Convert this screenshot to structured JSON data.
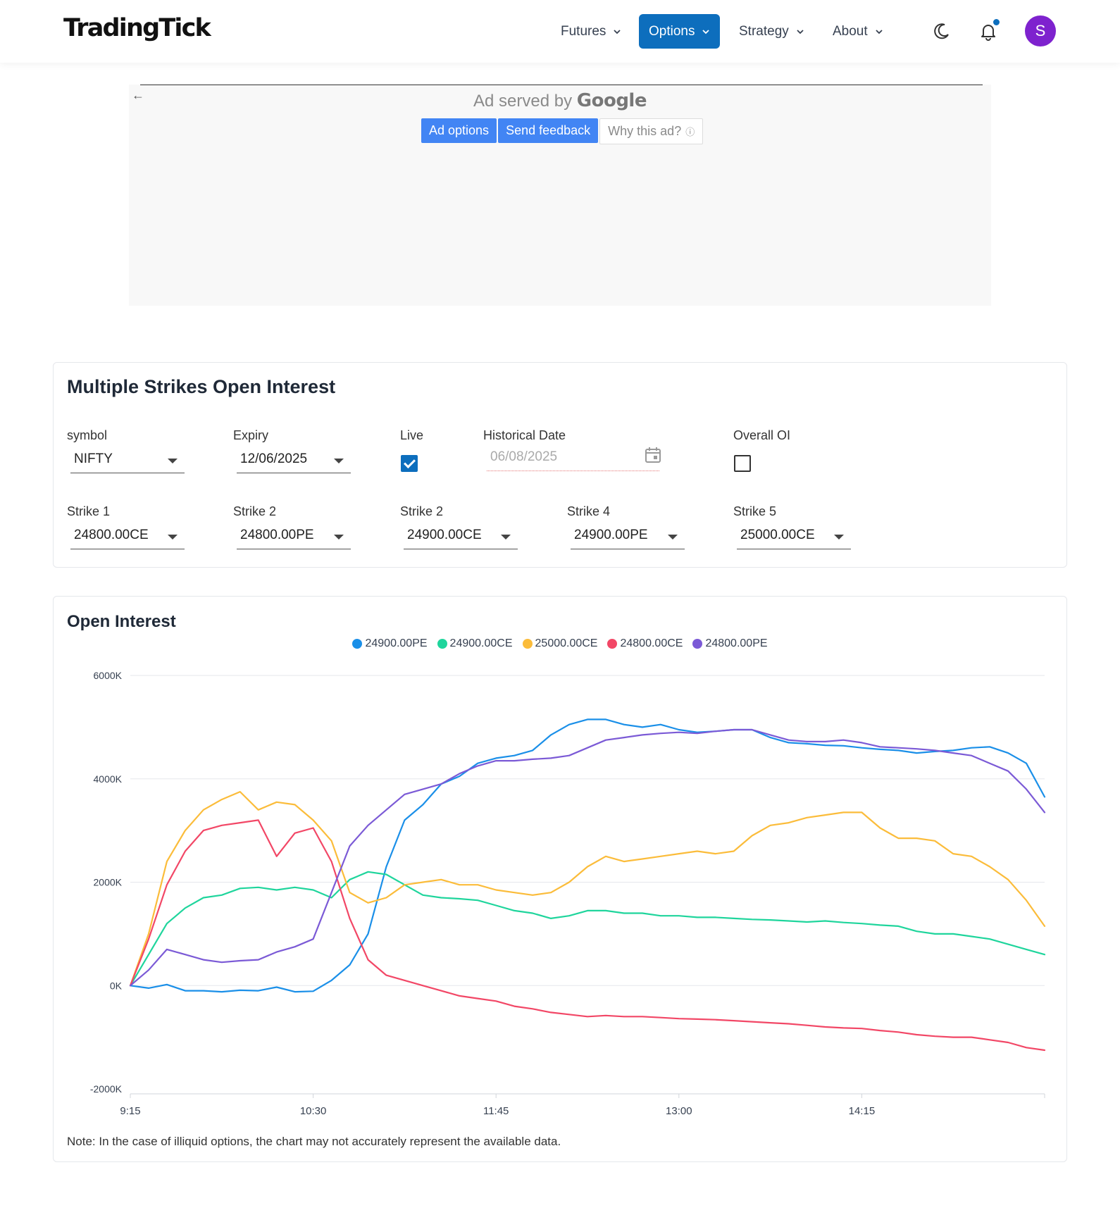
{
  "brand": "TradingTick",
  "nav": {
    "items": [
      {
        "label": "Futures",
        "active": false
      },
      {
        "label": "Options",
        "active": true
      },
      {
        "label": "Strategy",
        "active": false
      },
      {
        "label": "About",
        "active": false
      }
    ],
    "avatar_initial": "S"
  },
  "ad": {
    "served_by": "Ad served by",
    "google": "Google",
    "buttons": [
      "Ad options",
      "Send feedback",
      "Why this ad?"
    ]
  },
  "filters": {
    "title": "Multiple Strikes Open Interest",
    "symbol": {
      "label": "symbol",
      "value": "NIFTY"
    },
    "expiry": {
      "label": "Expiry",
      "value": "12/06/2025"
    },
    "live": {
      "label": "Live",
      "checked": true
    },
    "historical_date": {
      "label": "Historical Date",
      "value": "06/08/2025"
    },
    "overall_oi": {
      "label": "Overall OI",
      "checked": false
    },
    "strikes": [
      {
        "label": "Strike 1",
        "value": "24800.00CE"
      },
      {
        "label": "Strike 2",
        "value": "24800.00PE"
      },
      {
        "label": "Strike 2",
        "value": "24900.00CE"
      },
      {
        "label": "Strike 4",
        "value": "24900.00PE"
      },
      {
        "label": "Strike 5",
        "value": "25000.00CE"
      }
    ]
  },
  "oi_chart": {
    "title": "Open Interest",
    "note": "Note: In the case of illiquid options, the chart may not accurately represent the available data."
  },
  "chart_data": {
    "type": "line",
    "title": "Open Interest",
    "ylim": [
      -2000,
      6000
    ],
    "yticks": [
      "6000K",
      "4000K",
      "2000K",
      "0K",
      "-2000K"
    ],
    "ytick_values": [
      6000,
      4000,
      2000,
      0,
      -2000
    ],
    "xticks": [
      "9:15",
      "10:30",
      "11:45",
      "13:00",
      "14:15"
    ],
    "xtick_minutes": [
      0,
      75,
      150,
      225,
      300
    ],
    "x_range_minutes": [
      0,
      375
    ],
    "grid": true,
    "legend_position": "top-center",
    "series": [
      {
        "name": "24900.00PE",
        "color": "#1a8fe8",
        "points": [
          [
            0,
            0
          ],
          [
            10,
            -50
          ],
          [
            20,
            20
          ],
          [
            30,
            -100
          ],
          [
            40,
            -100
          ],
          [
            50,
            -120
          ],
          [
            60,
            -90
          ],
          [
            70,
            -100
          ],
          [
            80,
            -30
          ],
          [
            90,
            -120
          ],
          [
            100,
            -110
          ],
          [
            110,
            100
          ],
          [
            120,
            400
          ],
          [
            130,
            1000
          ],
          [
            140,
            2300
          ],
          [
            150,
            3200
          ],
          [
            160,
            3500
          ],
          [
            170,
            3900
          ],
          [
            180,
            4050
          ],
          [
            190,
            4300
          ],
          [
            200,
            4400
          ],
          [
            210,
            4450
          ],
          [
            220,
            4550
          ],
          [
            230,
            4850
          ],
          [
            240,
            5050
          ],
          [
            250,
            5150
          ],
          [
            260,
            5150
          ],
          [
            270,
            5050
          ],
          [
            280,
            5000
          ],
          [
            290,
            5050
          ],
          [
            300,
            4950
          ],
          [
            310,
            4900
          ],
          [
            320,
            4920
          ],
          [
            330,
            4950
          ],
          [
            340,
            4950
          ],
          [
            350,
            4800
          ],
          [
            360,
            4700
          ],
          [
            370,
            4680
          ],
          [
            380,
            4650
          ],
          [
            390,
            4640
          ],
          [
            400,
            4600
          ],
          [
            410,
            4570
          ],
          [
            420,
            4550
          ],
          [
            430,
            4500
          ],
          [
            440,
            4530
          ],
          [
            450,
            4550
          ],
          [
            460,
            4600
          ],
          [
            470,
            4620
          ],
          [
            480,
            4500
          ],
          [
            490,
            4300
          ],
          [
            500,
            3650
          ]
        ]
      },
      {
        "name": "24900.00CE",
        "color": "#1fd59c",
        "points": [
          [
            0,
            0
          ],
          [
            10,
            600
          ],
          [
            20,
            1200
          ],
          [
            30,
            1500
          ],
          [
            40,
            1700
          ],
          [
            50,
            1750
          ],
          [
            60,
            1880
          ],
          [
            70,
            1900
          ],
          [
            80,
            1850
          ],
          [
            90,
            1900
          ],
          [
            100,
            1850
          ],
          [
            110,
            1700
          ],
          [
            120,
            2050
          ],
          [
            130,
            2200
          ],
          [
            140,
            2150
          ],
          [
            150,
            1950
          ],
          [
            160,
            1750
          ],
          [
            170,
            1700
          ],
          [
            180,
            1680
          ],
          [
            190,
            1650
          ],
          [
            200,
            1550
          ],
          [
            210,
            1450
          ],
          [
            220,
            1400
          ],
          [
            230,
            1300
          ],
          [
            240,
            1350
          ],
          [
            250,
            1450
          ],
          [
            260,
            1450
          ],
          [
            270,
            1400
          ],
          [
            280,
            1400
          ],
          [
            290,
            1350
          ],
          [
            300,
            1350
          ],
          [
            310,
            1320
          ],
          [
            320,
            1320
          ],
          [
            330,
            1300
          ],
          [
            340,
            1280
          ],
          [
            350,
            1270
          ],
          [
            360,
            1250
          ],
          [
            370,
            1230
          ],
          [
            380,
            1250
          ],
          [
            390,
            1220
          ],
          [
            400,
            1200
          ],
          [
            410,
            1170
          ],
          [
            420,
            1150
          ],
          [
            430,
            1050
          ],
          [
            440,
            1000
          ],
          [
            450,
            1000
          ],
          [
            460,
            950
          ],
          [
            470,
            900
          ],
          [
            480,
            800
          ],
          [
            490,
            700
          ],
          [
            500,
            600
          ]
        ]
      },
      {
        "name": "25000.00CE",
        "color": "#fbbc3a",
        "points": [
          [
            0,
            0
          ],
          [
            10,
            1000
          ],
          [
            20,
            2400
          ],
          [
            30,
            3000
          ],
          [
            40,
            3400
          ],
          [
            50,
            3600
          ],
          [
            60,
            3750
          ],
          [
            70,
            3400
          ],
          [
            80,
            3550
          ],
          [
            90,
            3500
          ],
          [
            100,
            3200
          ],
          [
            110,
            2800
          ],
          [
            120,
            1800
          ],
          [
            130,
            1600
          ],
          [
            140,
            1700
          ],
          [
            150,
            1950
          ],
          [
            160,
            2000
          ],
          [
            170,
            2050
          ],
          [
            180,
            1950
          ],
          [
            190,
            1950
          ],
          [
            200,
            1850
          ],
          [
            210,
            1800
          ],
          [
            220,
            1750
          ],
          [
            230,
            1800
          ],
          [
            240,
            2000
          ],
          [
            250,
            2300
          ],
          [
            260,
            2500
          ],
          [
            270,
            2400
          ],
          [
            280,
            2450
          ],
          [
            290,
            2500
          ],
          [
            300,
            2550
          ],
          [
            310,
            2600
          ],
          [
            320,
            2550
          ],
          [
            330,
            2600
          ],
          [
            340,
            2900
          ],
          [
            350,
            3100
          ],
          [
            360,
            3150
          ],
          [
            370,
            3250
          ],
          [
            380,
            3300
          ],
          [
            390,
            3350
          ],
          [
            400,
            3350
          ],
          [
            410,
            3050
          ],
          [
            420,
            2850
          ],
          [
            430,
            2850
          ],
          [
            440,
            2800
          ],
          [
            450,
            2550
          ],
          [
            460,
            2500
          ],
          [
            470,
            2300
          ],
          [
            480,
            2050
          ],
          [
            490,
            1650
          ],
          [
            500,
            1150
          ]
        ]
      },
      {
        "name": "24800.00CE",
        "color": "#f24766",
        "points": [
          [
            0,
            0
          ],
          [
            10,
            900
          ],
          [
            20,
            1950
          ],
          [
            30,
            2600
          ],
          [
            40,
            3000
          ],
          [
            50,
            3100
          ],
          [
            60,
            3150
          ],
          [
            70,
            3200
          ],
          [
            80,
            2500
          ],
          [
            90,
            2950
          ],
          [
            100,
            3050
          ],
          [
            110,
            2400
          ],
          [
            120,
            1300
          ],
          [
            130,
            500
          ],
          [
            140,
            200
          ],
          [
            150,
            100
          ],
          [
            160,
            0
          ],
          [
            170,
            -100
          ],
          [
            180,
            -200
          ],
          [
            190,
            -250
          ],
          [
            200,
            -300
          ],
          [
            210,
            -400
          ],
          [
            220,
            -450
          ],
          [
            230,
            -520
          ],
          [
            240,
            -560
          ],
          [
            250,
            -600
          ],
          [
            260,
            -580
          ],
          [
            270,
            -600
          ],
          [
            280,
            -600
          ],
          [
            290,
            -620
          ],
          [
            300,
            -640
          ],
          [
            310,
            -650
          ],
          [
            320,
            -660
          ],
          [
            330,
            -680
          ],
          [
            340,
            -700
          ],
          [
            350,
            -720
          ],
          [
            360,
            -740
          ],
          [
            370,
            -770
          ],
          [
            380,
            -800
          ],
          [
            390,
            -820
          ],
          [
            400,
            -830
          ],
          [
            410,
            -870
          ],
          [
            420,
            -900
          ],
          [
            430,
            -950
          ],
          [
            440,
            -980
          ],
          [
            450,
            -1000
          ],
          [
            460,
            -1000
          ],
          [
            470,
            -1050
          ],
          [
            480,
            -1100
          ],
          [
            490,
            -1200
          ],
          [
            500,
            -1250
          ]
        ]
      },
      {
        "name": "24800.00PE",
        "color": "#7b5ad6",
        "points": [
          [
            0,
            0
          ],
          [
            10,
            300
          ],
          [
            20,
            700
          ],
          [
            30,
            600
          ],
          [
            40,
            500
          ],
          [
            50,
            450
          ],
          [
            60,
            480
          ],
          [
            70,
            500
          ],
          [
            80,
            650
          ],
          [
            90,
            750
          ],
          [
            100,
            900
          ],
          [
            110,
            1800
          ],
          [
            120,
            2700
          ],
          [
            130,
            3100
          ],
          [
            140,
            3400
          ],
          [
            150,
            3700
          ],
          [
            160,
            3800
          ],
          [
            170,
            3900
          ],
          [
            180,
            4100
          ],
          [
            190,
            4250
          ],
          [
            200,
            4350
          ],
          [
            210,
            4350
          ],
          [
            220,
            4380
          ],
          [
            230,
            4400
          ],
          [
            240,
            4450
          ],
          [
            250,
            4600
          ],
          [
            260,
            4750
          ],
          [
            270,
            4800
          ],
          [
            280,
            4850
          ],
          [
            290,
            4880
          ],
          [
            300,
            4900
          ],
          [
            310,
            4880
          ],
          [
            320,
            4920
          ],
          [
            330,
            4950
          ],
          [
            340,
            4950
          ],
          [
            350,
            4850
          ],
          [
            360,
            4750
          ],
          [
            370,
            4720
          ],
          [
            380,
            4720
          ],
          [
            390,
            4750
          ],
          [
            400,
            4700
          ],
          [
            410,
            4620
          ],
          [
            420,
            4600
          ],
          [
            430,
            4580
          ],
          [
            440,
            4550
          ],
          [
            450,
            4500
          ],
          [
            460,
            4450
          ],
          [
            470,
            4300
          ],
          [
            480,
            4150
          ],
          [
            490,
            3800
          ],
          [
            500,
            3350
          ]
        ]
      }
    ]
  }
}
